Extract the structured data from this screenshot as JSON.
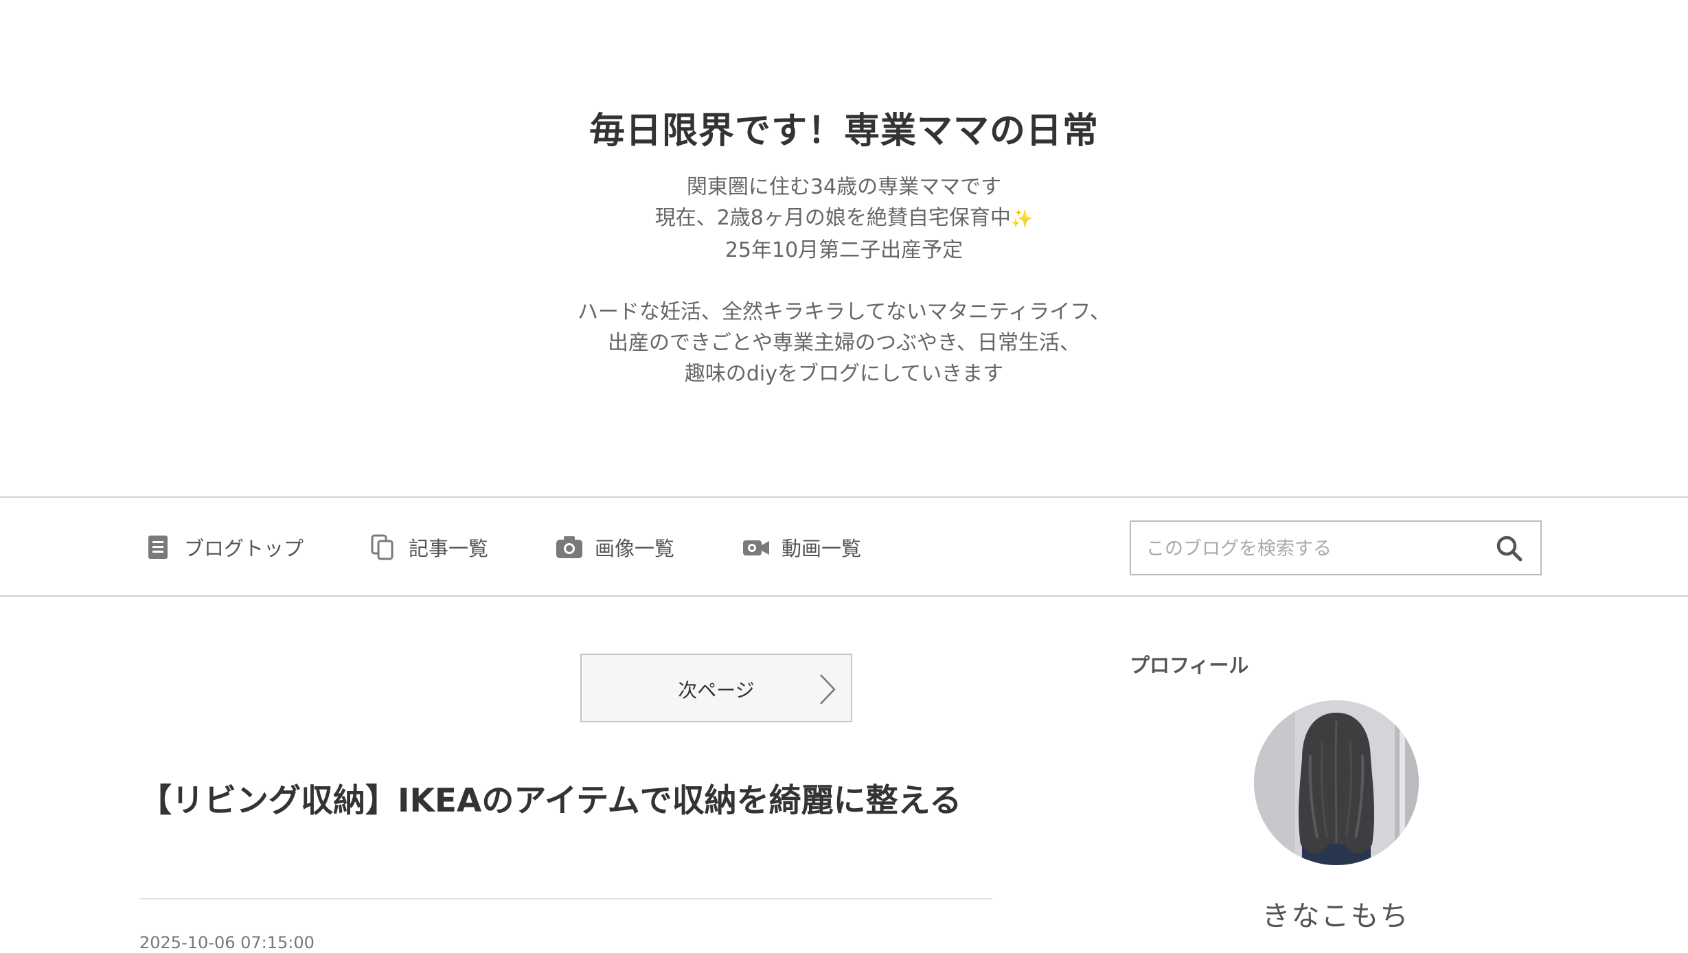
{
  "header": {
    "title": "毎日限界です！専業ママの日常",
    "description_lines": [
      "関東圏に住む34歳の専業ママです",
      "現在、2歳8ヶ月の娘を絶賛自宅保育中",
      "25年10月第二子出産予定"
    ],
    "description_lines_2": [
      "ハードな妊活、全然キラキラしてないマタニティライフ、",
      "出産のできごとや専業主婦のつぶやき、日常生活、",
      "趣味のdiyをブログにしていきます"
    ],
    "sparkle_icon": "sparkles-icon"
  },
  "nav": {
    "items": [
      {
        "label": "ブログトップ",
        "icon": "document-icon"
      },
      {
        "label": "記事一覧",
        "icon": "copy-icon"
      },
      {
        "label": "画像一覧",
        "icon": "camera-icon"
      },
      {
        "label": "動画一覧",
        "icon": "video-camera-icon"
      }
    ],
    "search": {
      "placeholder": "このブログを検索する",
      "value": "",
      "icon": "search-icon"
    }
  },
  "main": {
    "next_page_label": "次ページ",
    "article": {
      "title": "【リビング収納】IKEAのアイテムで収納を綺麗に整える",
      "date": "2025-10-06 07:15:00"
    }
  },
  "sidebar": {
    "profile_heading": "プロフィール",
    "profile_name": "きなこもち"
  },
  "colors": {
    "text_primary": "#333333",
    "text_secondary": "#666666",
    "border": "#d2d2d2",
    "icon_gray": "#7a7a7a"
  }
}
